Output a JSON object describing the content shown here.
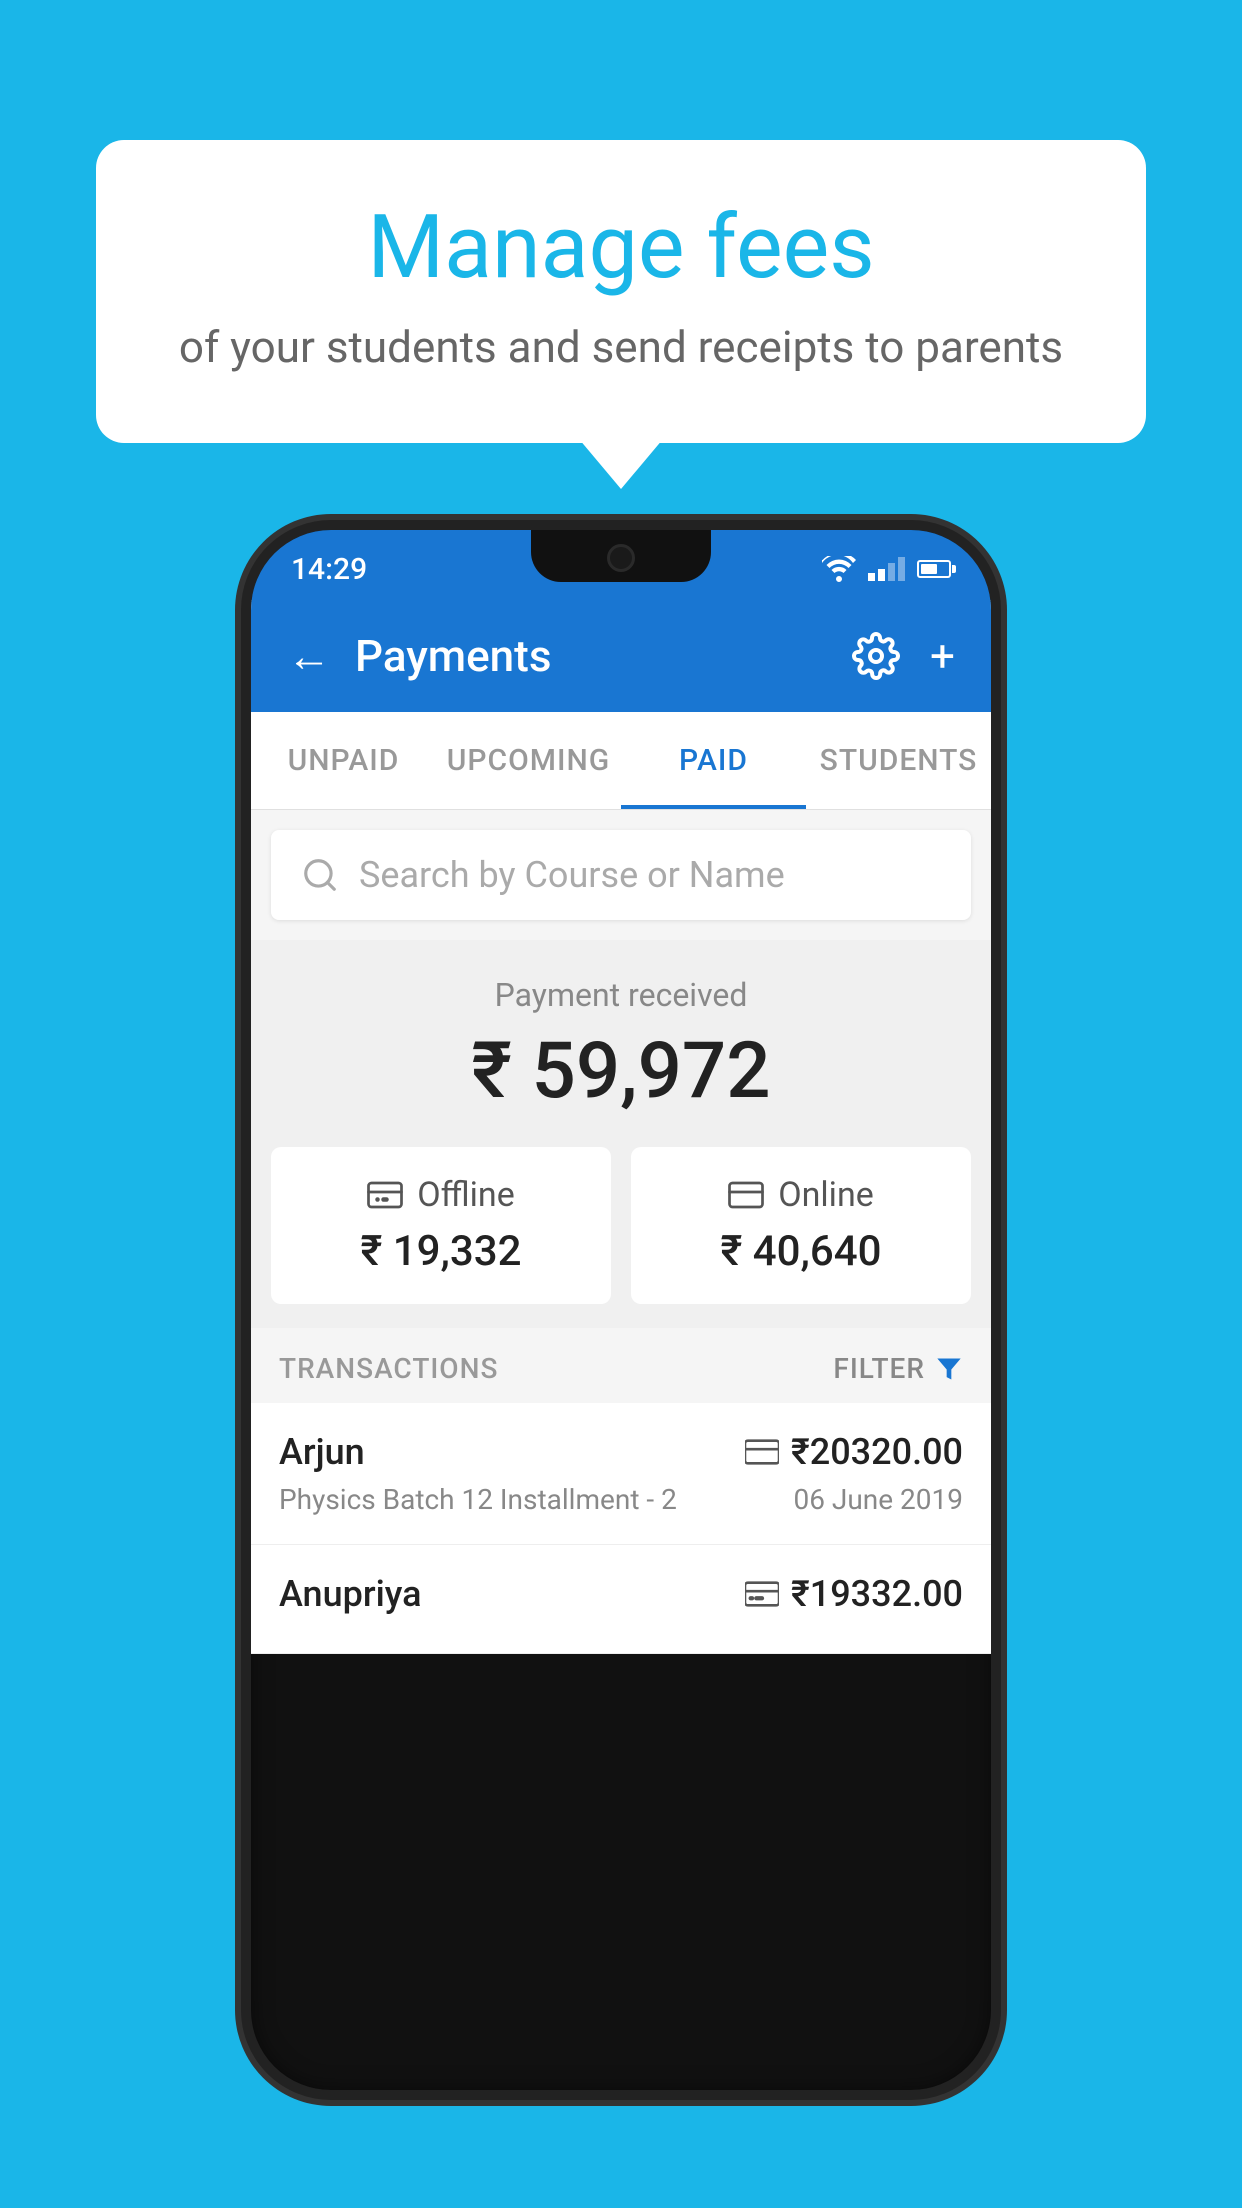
{
  "background_color": "#1ab6e8",
  "bubble": {
    "title": "Manage fees",
    "subtitle": "of your students and send receipts to parents"
  },
  "phone": {
    "status_bar": {
      "time": "14:29"
    },
    "header": {
      "title": "Payments",
      "back_label": "←",
      "plus_label": "+"
    },
    "tabs": [
      {
        "label": "UNPAID",
        "active": false
      },
      {
        "label": "UPCOMING",
        "active": false
      },
      {
        "label": "PAID",
        "active": true
      },
      {
        "label": "STUDENTS",
        "active": false
      }
    ],
    "search": {
      "placeholder": "Search by Course or Name"
    },
    "payment_received": {
      "label": "Payment received",
      "amount": "₹ 59,972"
    },
    "payment_cards": [
      {
        "icon": "offline",
        "label": "Offline",
        "amount": "₹ 19,332"
      },
      {
        "icon": "online",
        "label": "Online",
        "amount": "₹ 40,640"
      }
    ],
    "transactions_section": {
      "label": "TRANSACTIONS",
      "filter_label": "FILTER"
    },
    "transactions": [
      {
        "name": "Arjun",
        "payment_type": "online",
        "amount": "₹20320.00",
        "course": "Physics Batch 12 Installment - 2",
        "date": "06 June 2019"
      },
      {
        "name": "Anupriya",
        "payment_type": "offline",
        "amount": "₹19332.00",
        "course": "",
        "date": ""
      }
    ]
  }
}
